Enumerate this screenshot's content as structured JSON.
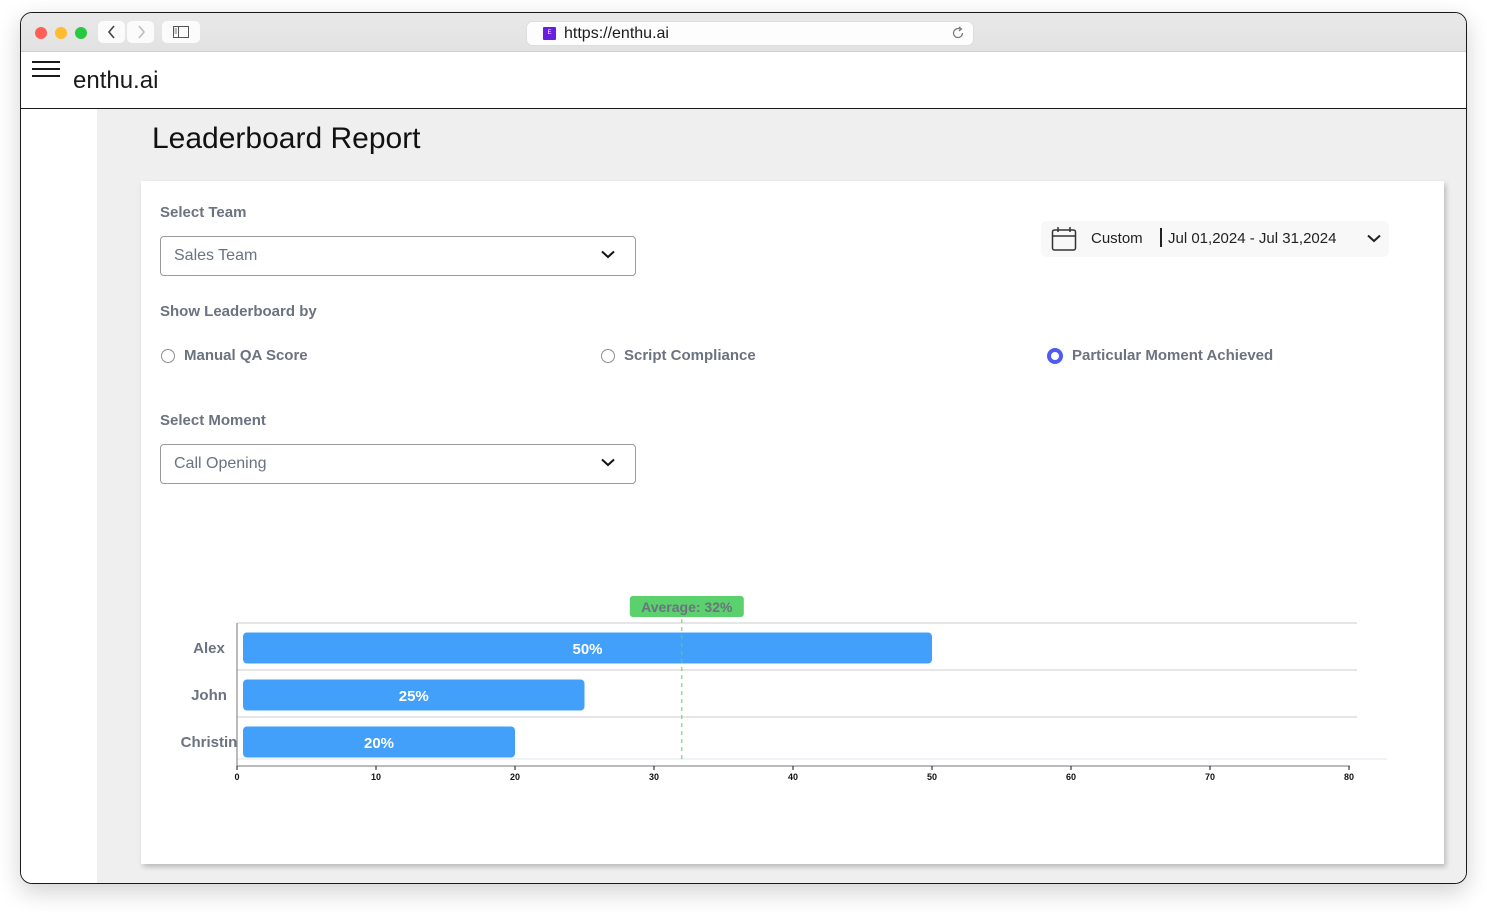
{
  "browser": {
    "url": "https://enthu.ai",
    "favicon_letter": "E",
    "back_icon": "chevron-left-icon",
    "forward_icon": "chevron-right-icon",
    "sidebar_icon": "sidebar-icon",
    "reload_icon": "reload-icon"
  },
  "app": {
    "brand": "enthu.ai",
    "menu_icon": "hamburger-icon"
  },
  "page": {
    "title": "Leaderboard Report"
  },
  "filters": {
    "team_label": "Select Team",
    "team_value": "Sales Team",
    "leaderboard_by_label": "Show Leaderboard by",
    "options": [
      {
        "label": "Manual QA Score",
        "selected": false
      },
      {
        "label": "Script Compliance",
        "selected": false
      },
      {
        "label": "Particular Moment Achieved",
        "selected": true
      }
    ],
    "moment_label": "Select Moment",
    "moment_value": "Call Opening",
    "date_mode": "Custom",
    "date_range": "Jul 01,2024 - Jul 31,2024",
    "accent_color": "#4f5bf2"
  },
  "chart_data": {
    "type": "bar",
    "orientation": "horizontal",
    "categories": [
      "Alex",
      "John",
      "Christin"
    ],
    "values": [
      50,
      25,
      20
    ],
    "value_labels": [
      "50%",
      "25%",
      "20%"
    ],
    "xlim": [
      0,
      80
    ],
    "xticks": [
      0,
      10,
      20,
      30,
      40,
      50,
      60,
      70,
      80
    ],
    "average": 32,
    "average_label": "Average: 32%",
    "bar_color": "#42a0fb",
    "average_color": "#5ad16c",
    "grid": true
  }
}
